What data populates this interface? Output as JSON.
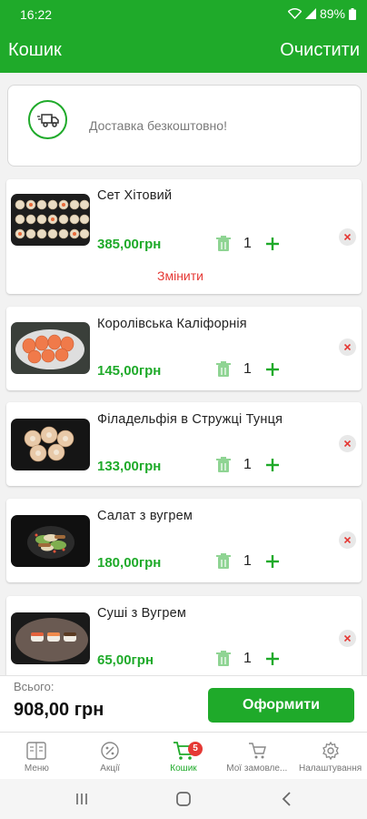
{
  "status_bar": {
    "time": "16:22",
    "battery": "89%"
  },
  "app_bar": {
    "title": "Кошик",
    "clear_label": "Очистити"
  },
  "delivery": {
    "text": "Доставка безкоштовно!"
  },
  "cart": {
    "items": [
      {
        "name": "Сет Хітовий",
        "price": "385,00грн",
        "quantity": "1",
        "change_label": "Змінити"
      },
      {
        "name": "Королівська Каліфорнія",
        "price": "145,00грн",
        "quantity": "1"
      },
      {
        "name": "Філадельфія в Стружці Тунця",
        "price": "133,00грн",
        "quantity": "1"
      },
      {
        "name": "Салат з вугрем",
        "price": "180,00грн",
        "quantity": "1"
      },
      {
        "name": "Суші з Вугрем",
        "price": "65,00грн",
        "quantity": "1"
      }
    ]
  },
  "total": {
    "label": "Всього:",
    "value": "908,00 грн",
    "checkout_label": "Оформити"
  },
  "bottom_nav": {
    "items": [
      {
        "label": "Меню",
        "icon": "menu-book-icon"
      },
      {
        "label": "Акції",
        "icon": "percent-icon"
      },
      {
        "label": "Кошик",
        "icon": "cart-icon",
        "active": true
      },
      {
        "label": "Мої замовле...",
        "icon": "orders-icon"
      },
      {
        "label": "Налаштування",
        "icon": "gear-icon"
      }
    ],
    "cart_badge": "5"
  },
  "colors": {
    "primary": "#1faa2a",
    "danger": "#e53935"
  }
}
